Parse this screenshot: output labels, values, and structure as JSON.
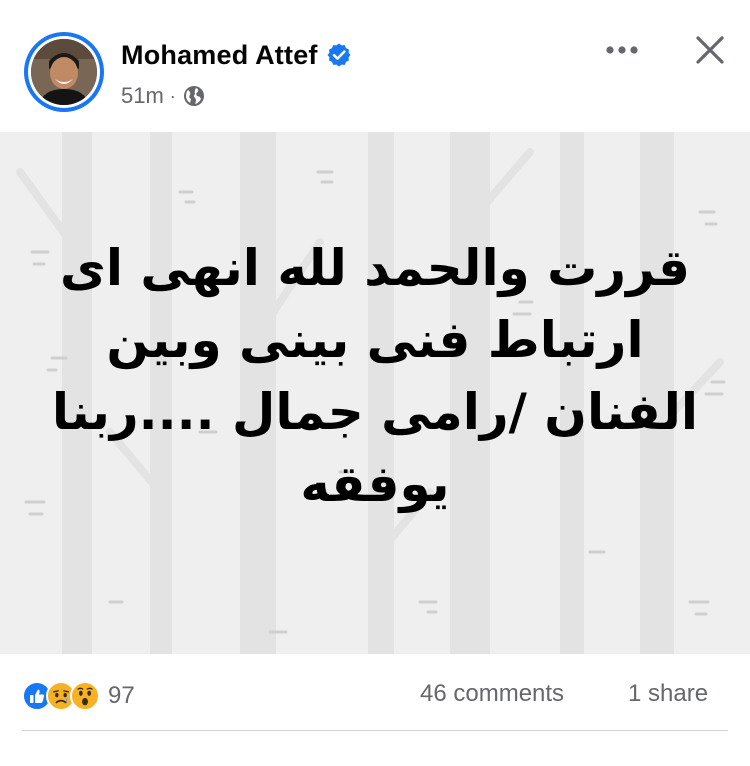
{
  "post": {
    "author_name": "Mohamed Attef",
    "verified": true,
    "timestamp": "51m",
    "separator": "·",
    "audience_icon": "globe-icon",
    "text": "قررت والحمد لله انهى اى\nارتباط فنى بينى وبين\nالفنان /رامى جمال ....ربنا\nيوفقه",
    "background_style": "birch-forest-gray"
  },
  "header": {
    "more_icon": "more-horizontal-icon",
    "close_icon": "close-icon"
  },
  "footer": {
    "reaction_icons": [
      "like-icon",
      "sad-icon",
      "wow-icon"
    ],
    "reaction_count": "97",
    "comments": "46 comments",
    "shares": "1 share"
  },
  "colors": {
    "brand_blue": "#1877f2",
    "secondary_text": "#65676b",
    "post_background": "#efefef",
    "top_strip": "#c9ccd1"
  }
}
